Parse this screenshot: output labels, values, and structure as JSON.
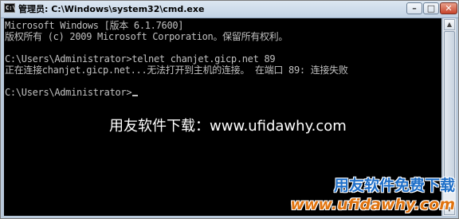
{
  "window": {
    "title": "管理员: C:\\Windows\\system32\\cmd.exe",
    "app_icon_text": "C:\\",
    "controls": {
      "minimize": "–",
      "maximize": "□",
      "close": "✕"
    }
  },
  "console": {
    "lines": [
      "Microsoft Windows [版本 6.1.7600]",
      "版权所有 (c) 2009 Microsoft Corporation。保留所有权利。",
      "",
      "C:\\Users\\Administrator>telnet chanjet.gicp.net 89",
      "正在连接chanjet.gicp.net...无法打开到主机的连接。 在端口 89: 连接失败",
      "",
      "C:\\Users\\Administrator>"
    ]
  },
  "scrollbar": {
    "up_arrow": "▲",
    "down_arrow": "▼"
  },
  "watermark": {
    "center_text": "用友软件下载：www.ufidawhy.com",
    "logo_top": "用友软件免费下载",
    "logo_bottom": "www.ufidawhy.com"
  },
  "colors": {
    "console_bg": "#000000",
    "console_text": "#c0c0c0",
    "logo_blue": "#1f6fc8",
    "logo_orange": "#e0730e"
  }
}
